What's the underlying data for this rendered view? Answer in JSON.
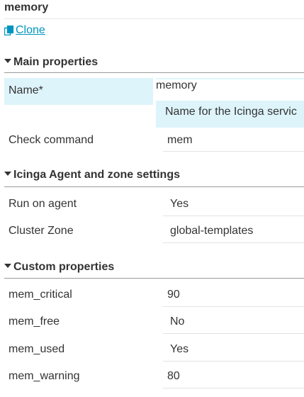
{
  "header": {
    "title": "memory",
    "clone_label": "Clone"
  },
  "sections": {
    "main": {
      "title": "Main properties",
      "name_label": "Name*",
      "name_value": "memory",
      "name_hint": "Name for the Icinga servic",
      "check_command_label": "Check command",
      "check_command_value": "mem"
    },
    "agent": {
      "title": "Icinga Agent and zone settings",
      "run_on_agent_label": "Run on agent",
      "run_on_agent_value": "Yes",
      "cluster_zone_label": "Cluster Zone",
      "cluster_zone_value": "global-templates"
    },
    "custom": {
      "title": "Custom properties",
      "mem_critical_label": "mem_critical",
      "mem_critical_value": "90",
      "mem_free_label": "mem_free",
      "mem_free_value": "No",
      "mem_used_label": "mem_used",
      "mem_used_value": "Yes",
      "mem_warning_label": "mem_warning",
      "mem_warning_value": "80"
    }
  },
  "colors": {
    "link": "#0095bf",
    "highlight": "#def4fb",
    "text": "#333333"
  },
  "icons": {
    "clone": "clone-icon",
    "caret": "caret-down-icon"
  }
}
